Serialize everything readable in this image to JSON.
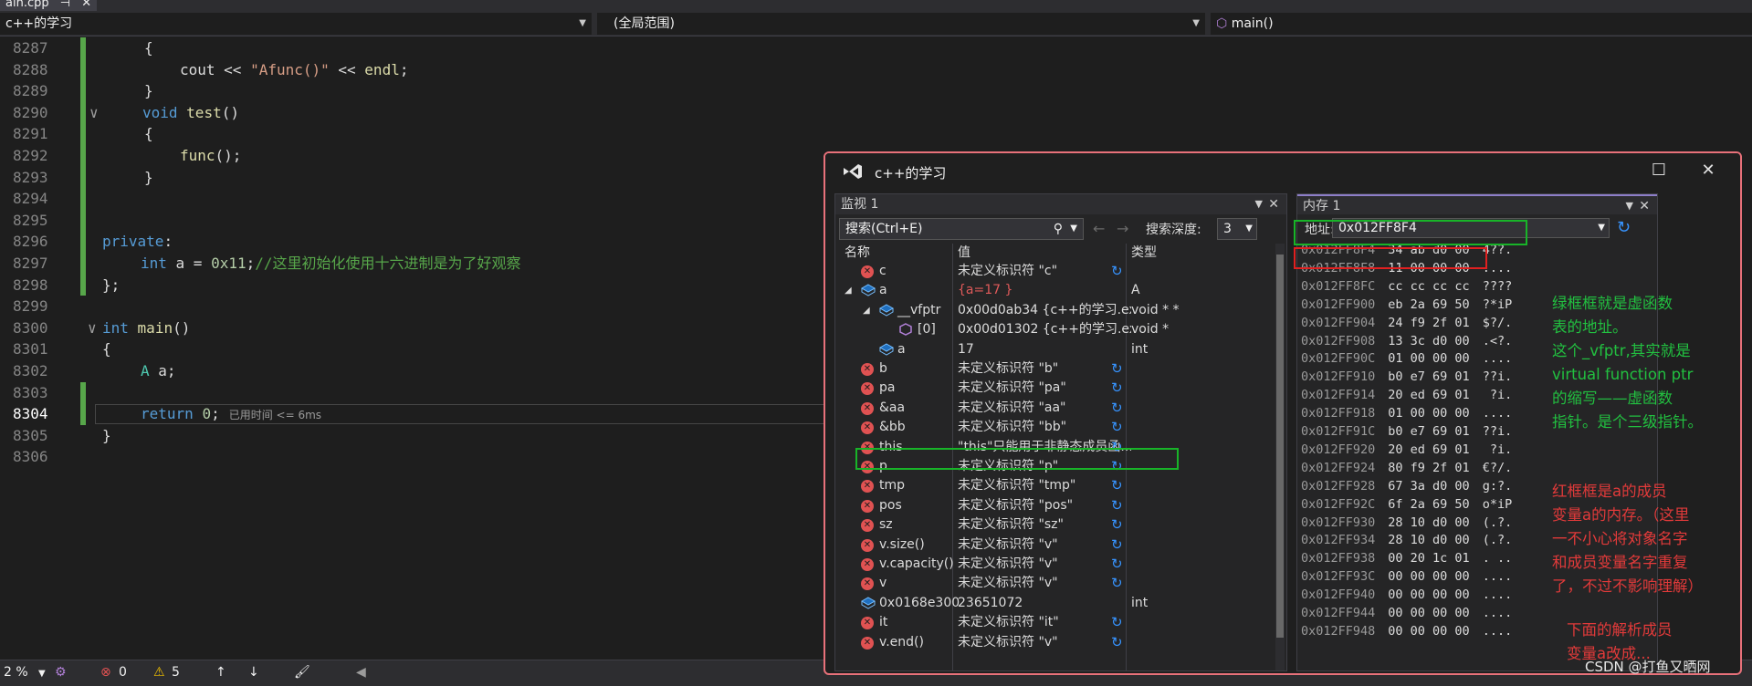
{
  "tab": {
    "label": "ain.cpp",
    "pin": "⊣",
    "close": "✕"
  },
  "navbar": {
    "project": "c++的学习",
    "scope": "(全局范围)",
    "function": "main()"
  },
  "editor": {
    "lines": [
      {
        "num": "8287",
        "code": "        {"
      },
      {
        "num": "8288",
        "code": "            cout << \"Afunc()\" << endl;"
      },
      {
        "num": "8289",
        "code": "        }"
      },
      {
        "num": "8290",
        "code": "    ∨   void test()"
      },
      {
        "num": "8291",
        "code": "        {"
      },
      {
        "num": "8292",
        "code": "            func();"
      },
      {
        "num": "8293",
        "code": "        }"
      },
      {
        "num": "8294",
        "code": ""
      },
      {
        "num": "8295",
        "code": ""
      },
      {
        "num": "8296",
        "code": "    private:"
      },
      {
        "num": "8297",
        "code": "        int a = 0x11;//这里初始化使用十六进制是为了好观察"
      },
      {
        "num": "8298",
        "code": "    };"
      },
      {
        "num": "8299",
        "code": ""
      },
      {
        "num": "8300",
        "code": "  ∨ int main()"
      },
      {
        "num": "8301",
        "code": "    {"
      },
      {
        "num": "8302",
        "code": "        A a;"
      },
      {
        "num": "8303",
        "code": ""
      },
      {
        "num": "8304",
        "code": "        return 0;"
      },
      {
        "num": "8305",
        "code": "    }"
      },
      {
        "num": "8306",
        "code": ""
      }
    ],
    "perf_tip": "已用时间 <= 6ms"
  },
  "statusbar": {
    "zoom": "2 %",
    "errors": "0",
    "warnings": "5"
  },
  "window": {
    "title": "c++的学习",
    "minimize": "☐",
    "close": "✕"
  },
  "watch": {
    "title": "监视 1",
    "search_placeholder": "搜索(Ctrl+E)",
    "depth_label": "搜索深度:",
    "depth_value": "3",
    "columns": {
      "name": "名称",
      "value": "值",
      "type": "类型"
    },
    "rows": [
      {
        "name": "c",
        "value": "未定义标识符 \"c\"",
        "type": "",
        "icon": "error",
        "indent": 0,
        "refresh": true
      },
      {
        "name": "a",
        "value": "{a=17 }",
        "type": "A",
        "icon": "object",
        "indent": 0,
        "expanded": true,
        "changed": true
      },
      {
        "name": "__vfptr",
        "value": "0x00d0ab34 {c++的学习.exe!voi...",
        "type": "void * *",
        "icon": "object",
        "indent": 1,
        "expanded": true
      },
      {
        "name": "[0]",
        "value": "0x00d01302 {c++的学习.exe!A::f...",
        "type": "void *",
        "icon": "cube",
        "indent": 2
      },
      {
        "name": "a",
        "value": "17",
        "type": "int",
        "icon": "field",
        "indent": 1
      },
      {
        "name": "b",
        "value": "未定义标识符 \"b\"",
        "type": "",
        "icon": "error",
        "indent": 0,
        "refresh": true
      },
      {
        "name": "pa",
        "value": "未定义标识符 \"pa\"",
        "type": "",
        "icon": "error",
        "indent": 0,
        "refresh": true
      },
      {
        "name": "&aa",
        "value": "未定义标识符 \"aa\"",
        "type": "",
        "icon": "error",
        "indent": 0,
        "refresh": true
      },
      {
        "name": "&bb",
        "value": "未定义标识符 \"bb\"",
        "type": "",
        "icon": "error",
        "indent": 0,
        "refresh": true
      },
      {
        "name": "this",
        "value": "\"this\"只能用于非静态成员函...",
        "type": "",
        "icon": "error",
        "indent": 0,
        "refresh": true
      },
      {
        "name": "p",
        "value": "未定义标识符 \"p\"",
        "type": "",
        "icon": "error",
        "indent": 0,
        "refresh": true
      },
      {
        "name": "tmp",
        "value": "未定义标识符 \"tmp\"",
        "type": "",
        "icon": "error",
        "indent": 0,
        "refresh": true
      },
      {
        "name": "pos",
        "value": "未定义标识符 \"pos\"",
        "type": "",
        "icon": "error",
        "indent": 0,
        "refresh": true
      },
      {
        "name": "sz",
        "value": "未定义标识符 \"sz\"",
        "type": "",
        "icon": "error",
        "indent": 0,
        "refresh": true
      },
      {
        "name": "v.size()",
        "value": "未定义标识符 \"v\"",
        "type": "",
        "icon": "error",
        "indent": 0,
        "refresh": true
      },
      {
        "name": "v.capacity()",
        "value": "未定义标识符 \"v\"",
        "type": "",
        "icon": "error",
        "indent": 0,
        "refresh": true
      },
      {
        "name": "v",
        "value": "未定义标识符 \"v\"",
        "type": "",
        "icon": "error",
        "indent": 0,
        "refresh": true
      },
      {
        "name": "0x0168e300",
        "value": "23651072",
        "type": "int",
        "icon": "object",
        "indent": 0
      },
      {
        "name": "it",
        "value": "未定义标识符 \"it\"",
        "type": "",
        "icon": "error",
        "indent": 0,
        "refresh": true
      },
      {
        "name": "v.end()",
        "value": "未定义标识符 \"v\"",
        "type": "",
        "icon": "error",
        "indent": 0,
        "refresh": true
      }
    ]
  },
  "memory": {
    "title": "内存 1",
    "address_label": "地址:",
    "address_value": "0x012FF8F4",
    "rows": [
      {
        "addr": "0x012FF8F4",
        "bytes": "34 ab d0 00",
        "chars": "4??."
      },
      {
        "addr": "0x012FF8F8",
        "bytes": "11 00 00 00",
        "chars": "...."
      },
      {
        "addr": "0x012FF8FC",
        "bytes": "cc cc cc cc",
        "chars": "????"
      },
      {
        "addr": "0x012FF900",
        "bytes": "eb 2a 69 50",
        "chars": "?*iP"
      },
      {
        "addr": "0x012FF904",
        "bytes": "24 f9 2f 01",
        "chars": "$?/."
      },
      {
        "addr": "0x012FF908",
        "bytes": "13 3c d0 00",
        "chars": ".<?."
      },
      {
        "addr": "0x012FF90C",
        "bytes": "01 00 00 00",
        "chars": "...."
      },
      {
        "addr": "0x012FF910",
        "bytes": "b0 e7 69 01",
        "chars": "??i."
      },
      {
        "addr": "0x012FF914",
        "bytes": "20 ed 69 01",
        "chars": " ?i."
      },
      {
        "addr": "0x012FF918",
        "bytes": "01 00 00 00",
        "chars": "...."
      },
      {
        "addr": "0x012FF91C",
        "bytes": "b0 e7 69 01",
        "chars": "??i."
      },
      {
        "addr": "0x012FF920",
        "bytes": "20 ed 69 01",
        "chars": " ?i."
      },
      {
        "addr": "0x012FF924",
        "bytes": "80 f9 2f 01",
        "chars": "€?/."
      },
      {
        "addr": "0x012FF928",
        "bytes": "67 3a d0 00",
        "chars": "g:?."
      },
      {
        "addr": "0x012FF92C",
        "bytes": "6f 2a 69 50",
        "chars": "o*iP"
      },
      {
        "addr": "0x012FF930",
        "bytes": "28 10 d0 00",
        "chars": "(.?."
      },
      {
        "addr": "0x012FF934",
        "bytes": "28 10 d0 00",
        "chars": "(.?."
      },
      {
        "addr": "0x012FF938",
        "bytes": "00 20 1c 01",
        "chars": ". .."
      },
      {
        "addr": "0x012FF93C",
        "bytes": "00 00 00 00",
        "chars": "...."
      },
      {
        "addr": "0x012FF940",
        "bytes": "00 00 00 00",
        "chars": "...."
      },
      {
        "addr": "0x012FF944",
        "bytes": "00 00 00 00",
        "chars": "...."
      },
      {
        "addr": "0x012FF948",
        "bytes": "00 00 00 00",
        "chars": "...."
      }
    ]
  },
  "annotations": {
    "green": [
      "绿框框就是虚函数",
      "表的地址。",
      "这个_vfptr,其实就是",
      "virtual function ptr",
      "的缩写——虚函数",
      "指针。是个三级指针。"
    ],
    "red": [
      "红框框是a的成员",
      "变量a的内存。（这里",
      "一不小心将对象名字",
      "和成员变量名字重复",
      "了，不过不影响理解）"
    ],
    "red_tail": [
      "下面的解析成员",
      "变量a改成..."
    ]
  },
  "watermark": "CSDN @打鱼又晒网",
  "colors": {
    "accent_green": "#18b428",
    "accent_red": "#e02020",
    "window_border": "#e8717a"
  }
}
